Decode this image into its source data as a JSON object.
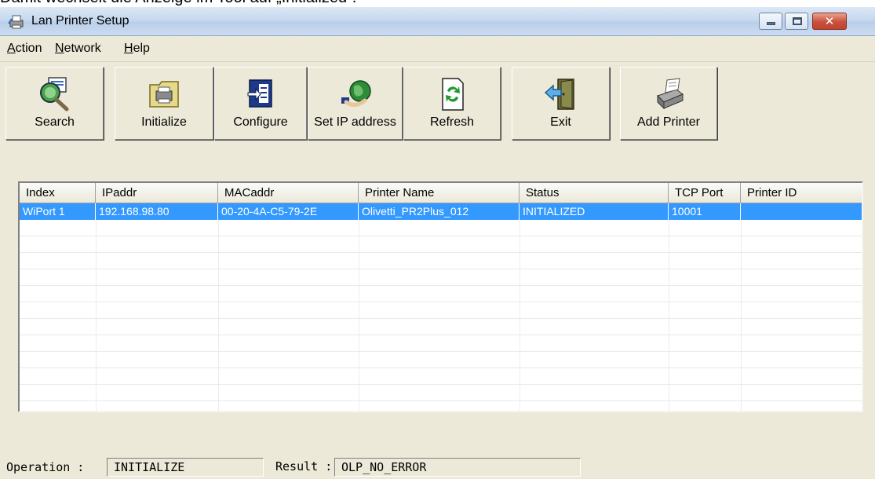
{
  "caption": "Damit wechselt die Anzeige im Tool auf „Initialized“.",
  "window": {
    "title": "Lan Printer Setup",
    "icon": "printer-setup-icon",
    "controls": [
      "minimize",
      "maximize",
      "close"
    ]
  },
  "menu": {
    "items": [
      {
        "label": "Action",
        "mnemonic": "A"
      },
      {
        "label": "Network",
        "mnemonic": "N"
      },
      {
        "label": "Help",
        "mnemonic": "H"
      }
    ]
  },
  "toolbar": {
    "buttons": [
      {
        "label": "Search",
        "icon": "search-magnifier-icon"
      },
      {
        "label": "Initialize",
        "icon": "initialize-printer-icon"
      },
      {
        "label": "Configure",
        "icon": "configure-icon"
      },
      {
        "label": "Set IP address",
        "icon": "set-ip-globe-icon"
      },
      {
        "label": "Refresh",
        "icon": "refresh-icon"
      },
      {
        "label": "Exit",
        "icon": "exit-door-icon"
      },
      {
        "label": "Add Printer",
        "icon": "add-printer-icon"
      }
    ]
  },
  "table": {
    "columns": [
      "Index",
      "IPaddr",
      "MACaddr",
      "Printer Name",
      "Status",
      "TCP Port",
      "Printer ID"
    ],
    "rows": [
      [
        "WiPort 1",
        "192.168.98.80",
        "00-20-4A-C5-79-2E",
        "Olivetti_PR2Plus_012",
        "INITIALIZED",
        "10001",
        ""
      ]
    ],
    "selected_row": 0
  },
  "statusbar": {
    "operation_label": "Operation :",
    "operation_value": "INITIALIZE",
    "result_label": "Result :",
    "result_value": "OLP_NO_ERROR"
  },
  "colors": {
    "selection": "#3399ff",
    "window_bg": "#ece9d8",
    "title_gradient": "#c6d8ee",
    "close_button": "#c8503a"
  }
}
